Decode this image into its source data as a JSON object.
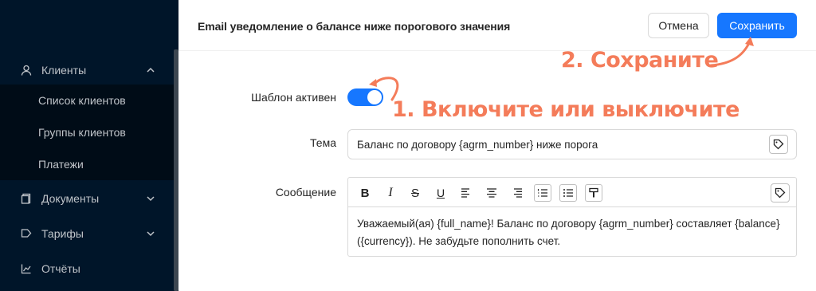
{
  "sidebar": {
    "items": [
      {
        "label": "Клиенты",
        "icon": "user-icon",
        "expanded": true
      },
      {
        "label": "Документы",
        "icon": "document-icon",
        "expanded": false
      },
      {
        "label": "Тарифы",
        "icon": "tag-icon",
        "expanded": false
      },
      {
        "label": "Отчёты",
        "icon": "chart-icon"
      }
    ],
    "subitems": [
      {
        "label": "Список клиентов"
      },
      {
        "label": "Группы клиентов"
      },
      {
        "label": "Платежи"
      }
    ]
  },
  "header": {
    "title": "Email уведомление о балансе ниже порогового значения",
    "cancel_label": "Отмена",
    "save_label": "Сохранить"
  },
  "form": {
    "active_label": "Шаблон активен",
    "active": true,
    "subject_label": "Тема",
    "subject_value": "Баланс по договору {agrm_number} ниже порога",
    "message_label": "Сообщение",
    "message_value": "Уважаемый(ая) {full_name}! Баланс по договору {agrm_number} составляет {balance} ({currency}). Не забудьте пополнить счет.",
    "toolbar": [
      "bold-icon",
      "italic-icon",
      "strikethrough-icon",
      "underline-icon",
      "align-left-icon",
      "align-center-icon",
      "align-right-icon",
      "ordered-list-icon",
      "bullet-list-icon",
      "format-painter-icon",
      "variable-tag-icon"
    ]
  },
  "annotations": {
    "step1": "1. Включите или выключите",
    "step2": "2. Сохраните"
  },
  "colors": {
    "sidebar_bg": "#001529",
    "primary": "#1677ff",
    "annotation": "#f47c5a"
  }
}
